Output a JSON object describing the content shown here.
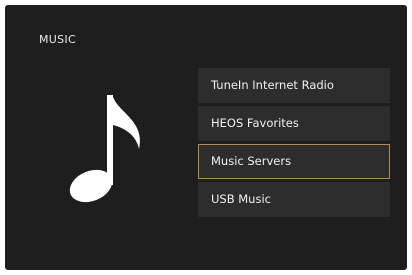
{
  "screen": {
    "title": "MUSIC",
    "icon": "music-note-icon"
  },
  "menu": {
    "items": [
      {
        "label": "TuneIn Internet Radio"
      },
      {
        "label": "HEOS Favorites"
      },
      {
        "label": "Music Servers",
        "selected": true
      },
      {
        "label": "USB Music"
      }
    ],
    "selected_index": 2
  },
  "colors": {
    "background": "#1e1e1e",
    "item_background": "#2d2d2d",
    "selection_border": "#b08a5a",
    "text": "#f0f0f0"
  }
}
